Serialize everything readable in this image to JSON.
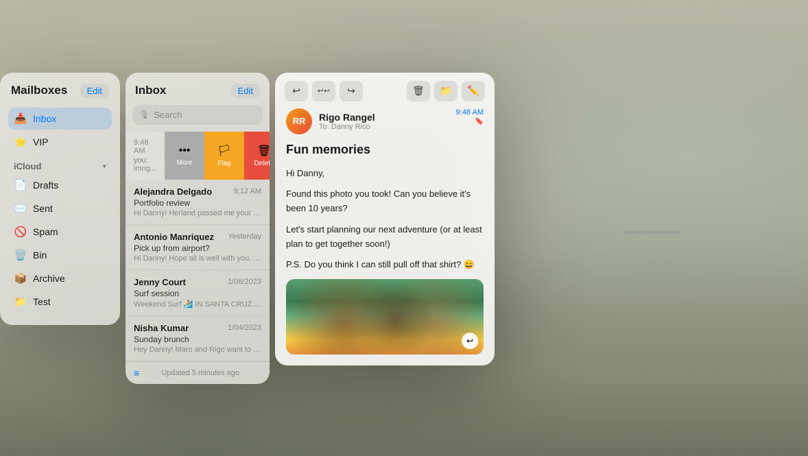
{
  "background": {
    "description": "Living room VR environment"
  },
  "mailboxes_panel": {
    "title": "Mailboxes",
    "edit_label": "Edit",
    "items": [
      {
        "id": "inbox",
        "label": "Inbox",
        "icon": "📥",
        "active": true
      },
      {
        "id": "vip",
        "label": "VIP",
        "icon": "⭐",
        "active": false
      }
    ],
    "sections": [
      {
        "title": "iCloud",
        "expanded": true,
        "items": [
          {
            "id": "drafts",
            "label": "Drafts",
            "icon": "📄"
          },
          {
            "id": "sent",
            "label": "Sent",
            "icon": "✉️"
          },
          {
            "id": "spam",
            "label": "Spam",
            "icon": "🚫"
          },
          {
            "id": "bin",
            "label": "Bin",
            "icon": "🗑️"
          },
          {
            "id": "archive",
            "label": "Archive",
            "icon": "📦"
          },
          {
            "id": "test",
            "label": "Test",
            "icon": "📁"
          }
        ]
      }
    ]
  },
  "inbox_panel": {
    "title": "Inbox",
    "edit_label": "Edit",
    "search_placeholder": "Search",
    "swipe_buttons": [
      {
        "id": "more",
        "label": "More",
        "icon": "•••"
      },
      {
        "id": "flag",
        "label": "Flag",
        "icon": "🏳"
      },
      {
        "id": "delete",
        "label": "Delete",
        "icon": "🗑"
      }
    ],
    "emails": [
      {
        "id": "1",
        "sender": "Alejandra Delgado",
        "time": "9:12 AM",
        "subject": "Portfolio review",
        "preview": "Hi Danny! Herland passed me your contact info at his housewarming party last week and sai..."
      },
      {
        "id": "2",
        "sender": "Antonio Manriquez",
        "time": "Yesterday",
        "subject": "Pick up from airport?",
        "preview": "Hi Danny! Hope all is well with you. I'm coming home from London and was wondering if you..."
      },
      {
        "id": "3",
        "sender": "Jenny Court",
        "time": "1/08/2023",
        "subject": "Surf session",
        "preview": "Weekend Surf 🏄 IN SANTA CRUZ Glassy waves Chill vibes Delicious snacks Sunrise to..."
      },
      {
        "id": "4",
        "sender": "Nisha Kumar",
        "time": "1/04/2023",
        "subject": "Sunday brunch",
        "preview": "Hey Danny! Maro and Rigo want to come to..."
      }
    ],
    "status_text": "Updated 5 minutes ago"
  },
  "detail_panel": {
    "toolbar_buttons": [
      {
        "id": "reply",
        "icon": "↩"
      },
      {
        "id": "forward-all",
        "icon": "↩↩"
      },
      {
        "id": "forward",
        "icon": "↪"
      },
      {
        "id": "delete",
        "icon": "🗑"
      },
      {
        "id": "folder",
        "icon": "📁"
      },
      {
        "id": "compose",
        "icon": "✏️"
      }
    ],
    "email": {
      "sender_name": "Rigo Rangel",
      "sender_initials": "RR",
      "to": "To: Danny Rico",
      "time": "9:48 AM",
      "subject": "Fun memories",
      "body_lines": [
        "Hi Danny,",
        "Found this photo you took! Can you believe it's been 10 years?",
        "Let's start planning our next adventure (or at least plan to get together soon!)",
        "P.S. Do you think I can still pull off that shirt? 😄"
      ],
      "has_photo": true
    }
  },
  "scroll_indicator": {
    "visible": true
  }
}
